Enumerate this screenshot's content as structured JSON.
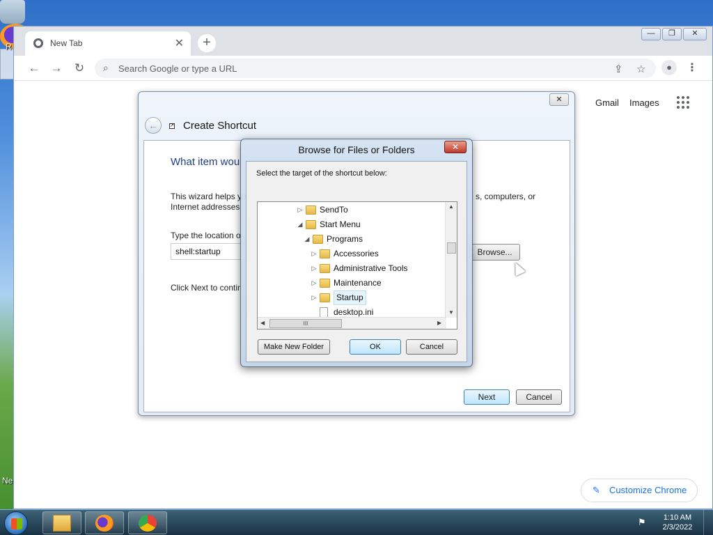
{
  "desktop": {
    "left_text_top": "R",
    "left_text_bottom": "Ne"
  },
  "browser": {
    "tab_title": "New Tab",
    "tab_close": "✕",
    "new_tab": "+",
    "win_minimize": "—",
    "win_restore": "❐",
    "win_close": "✕",
    "back": "←",
    "forward": "→",
    "reload": "↻",
    "omnibox_placeholder": "Search Google or type a URL",
    "links": {
      "gmail": "Gmail",
      "images": "Images"
    },
    "customize_label": "Customize Chrome",
    "icons": [
      "search-icon",
      "share-icon",
      "star-icon",
      "profile-icon",
      "menu-icon",
      "apps-icon",
      "pencil-icon"
    ]
  },
  "wizard": {
    "close": "✕",
    "title": "Create Shortcut",
    "heading": "What item wou",
    "intro_left": "This wizard helps yo",
    "intro_left2": "Internet addresses.",
    "intro_right": "s, computers, or",
    "location_label": "Type the location o",
    "location_value": "shell:startup",
    "browse_label": "Browse...",
    "next_hint": "Click Next to contin",
    "next_label": "Next",
    "cancel_label": "Cancel"
  },
  "browse_dialog": {
    "title": "Browse for Files or Folders",
    "close": "✕",
    "prompt": "Select the target of the shortcut below:",
    "tree": [
      {
        "label": "SendTo",
        "arrow": "▷",
        "type": "folder",
        "indent": 0
      },
      {
        "label": "Start Menu",
        "arrow": "◢",
        "type": "folder",
        "indent": 0
      },
      {
        "label": "Programs",
        "arrow": "◢",
        "type": "folder",
        "indent": 1
      },
      {
        "label": "Accessories",
        "arrow": "▷",
        "type": "folder",
        "indent": 2
      },
      {
        "label": "Administrative Tools",
        "arrow": "▷",
        "type": "folder",
        "indent": 2
      },
      {
        "label": "Maintenance",
        "arrow": "▷",
        "type": "folder",
        "indent": 2
      },
      {
        "label": "Startup",
        "arrow": "▷",
        "type": "folder",
        "indent": 2,
        "selected": true
      },
      {
        "label": "desktop.ini",
        "arrow": "",
        "type": "file",
        "indent": 2
      }
    ],
    "scroll_up": "▲",
    "scroll_down": "▼",
    "scroll_left": "◀",
    "scroll_right": "▶",
    "scroll_grip": "III",
    "make_new_folder": "Make New Folder",
    "ok": "OK",
    "cancel": "Cancel"
  },
  "taskbar": {
    "time": "1:10 AM",
    "date": "2/3/2022",
    "apps": [
      "file-explorer-icon",
      "firefox-icon",
      "chrome-icon"
    ]
  }
}
